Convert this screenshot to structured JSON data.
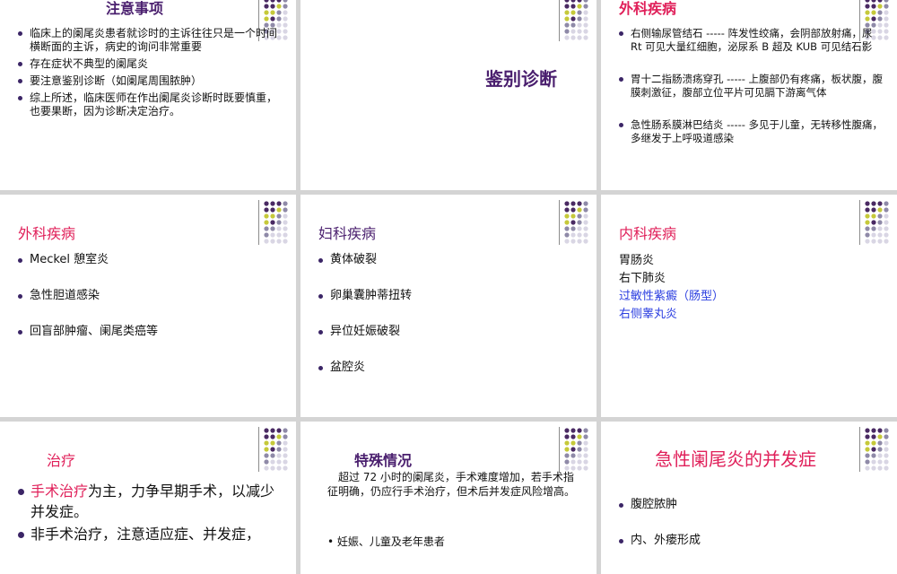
{
  "slides": {
    "precautions": {
      "title": "注意事项",
      "items": [
        "临床上的阑尾炎患者就诊时的主诉往往只是一个时间横断面的主诉，病史的询问非常重要",
        "存在症状不典型的阑尾炎",
        "要注意鉴别诊断（如阑尾周围脓肿）",
        "综上所述，临床医师在作出阑尾炎诊断时既要慎重，也要果断，因为诊断决定治疗。"
      ]
    },
    "differential": {
      "title": "鉴别诊断"
    },
    "surgical_1": {
      "title": "外科疾病",
      "items": [
        "右侧输尿管结石 ----- 阵发性绞痛，会阴部放射痛，尿Rt 可见大量红细胞，泌尿系 B 超及 KUB 可见结石影",
        "胃十二指肠溃疡穿孔 ----- 上腹部仍有疼痛，板状腹，腹膜刺激征，腹部立位平片可见膈下游离气体",
        "急性肠系膜淋巴结炎 ----- 多见于儿童，无转移性腹痛，多继发于上呼吸道感染"
      ]
    },
    "surgical_2": {
      "title": "外科疾病",
      "items": [
        "Meckel 憩室炎",
        "急性胆道感染",
        "回盲部肿瘤、阑尾类癌等"
      ]
    },
    "gynecologic": {
      "title": "妇科疾病",
      "items": [
        "黄体破裂",
        "卵巢囊肿蒂扭转",
        "异位妊娠破裂",
        "盆腔炎"
      ]
    },
    "internal": {
      "title": "内科疾病",
      "items": [
        {
          "text": "胃肠炎",
          "color": "#111111"
        },
        {
          "text": "右下肺炎",
          "color": "#111111"
        },
        {
          "text": "过敏性紫癜（肠型）",
          "color": "#2b3ee0"
        },
        {
          "text": "右侧睾丸炎",
          "color": "#2b3ee0"
        }
      ]
    },
    "treatment": {
      "title": "治疗",
      "item1_highlight": "手术治疗",
      "item1_rest": "为主，力争早期手术，以减少并发症。",
      "item2": "非手术治疗，注意适应症、并发症，"
    },
    "special": {
      "title": "特殊情况",
      "paragraph": "超过 72 小时的阑尾炎，手术难度增加，若手术指征明确，仍应行手术治疗，但术后并发症风险增高。",
      "partial": "• 妊娠、儿童及老年患者"
    },
    "complications": {
      "title": "急性阑尾炎的并发症",
      "items": [
        "腹腔脓肿",
        "内、外瘘形成"
      ]
    }
  },
  "decoration": {
    "dot_colors": [
      "#4a2a63",
      "#c6c93a",
      "#8f8aa8",
      "#d9d6e4"
    ]
  }
}
